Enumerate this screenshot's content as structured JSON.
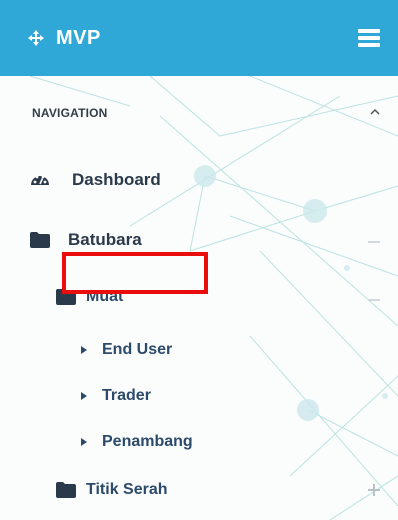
{
  "header": {
    "brand": "MVP",
    "brand_icon": "move-arrows-icon",
    "menu_icon": "hamburger-menu-icon",
    "color": "#2fa7d7"
  },
  "nav": {
    "section_title": "NAVIGATION",
    "items": {
      "dashboard": {
        "label": "Dashboard",
        "icon": "dashboard-gauge-icon"
      },
      "batubara": {
        "label": "Batubara",
        "icon": "folder-icon",
        "expanded": true
      },
      "muat": {
        "label": "Muat",
        "icon": "folder-icon",
        "expanded": true
      },
      "end_user": {
        "label": "End User",
        "icon": "caret-right-icon",
        "highlighted": true
      },
      "trader": {
        "label": "Trader",
        "icon": "caret-right-icon"
      },
      "penambang": {
        "label": "Penambang",
        "icon": "caret-right-icon"
      },
      "titik_serah": {
        "label": "Titik Serah",
        "icon": "folder-icon",
        "expanded": false
      }
    }
  },
  "colors": {
    "highlight_border": "#ea0d0d",
    "text": "#2b3a4a"
  }
}
